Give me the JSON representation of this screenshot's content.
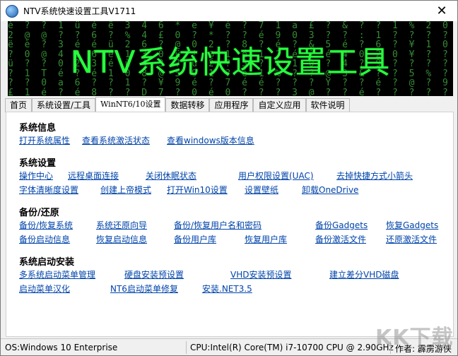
{
  "window": {
    "title": "NTV系统快速设置工具V1711",
    "close_label": "✕"
  },
  "banner": {
    "title": "NTV系统快速设置工具",
    "matrix_rows": [
      "è ? ? 1 ü é ë 3 4 6 * e ¥ é ? 7 1 a £ ? & ? ? 1 % 2 0 ? ? @ 2 ú è ¥ 5 ú",
      "2 @ @ ? ? 6 ? % 4 £ 0 ? * ? ? é 9 0 3 ? ? : 1 ? ? ? ? ë 2 & 4 9 : 2 ? 1",
      "ë è ? 3 é é ü 2 6 ? @ 0 2 ? 8 ? é ? & 5 é ? 6 ? ¥ 1 0 2 8 é 3 @ T a ù",
      "? 0 @ 4 ? 6 é 1 3 0 ü ! @ 1 é 1 ? é ? é 4 0 2 0 ¥ ? ? ? 1 2 4 ? ? ? ? ?",
      "ü ? ? 0 2 3 é ù 4 3 ? ü 2 ? 5 ? è 1 0 ? 4 ? 9 ? ? ? ? 3 ? 6 a 4 ? 9 ?",
      "? 1 T é ? é 1 0 8 @ 5 9 1 ? é 1 % ? ? @ 3 & ? ? 5 % ? ? ? 2 2 ? 3 0 ?",
      "? ? 0 a 6 ? ? 1 ? ¥ 9 é ? 7 é é ? ? ? Y ? ? é ? @ ? 9 2 1 7 ? 8 ? ? ? 9",
      "£ 1 é ? é 8 ? ? D 7 ? 0 é 0 ? ? ? 3 @ ? ? é ? ? ? ? ? ? 4 ? 7 3 ? ? % ?"
    ]
  },
  "tabs": [
    {
      "label": "首页",
      "active": false
    },
    {
      "label": "系统设置/工具",
      "active": false
    },
    {
      "label": "WinNT6/10设置",
      "active": true
    },
    {
      "label": "数据转移",
      "active": false
    },
    {
      "label": "应用程序",
      "active": false
    },
    {
      "label": "自定义应用",
      "active": false
    },
    {
      "label": "软件说明",
      "active": false
    }
  ],
  "sections": {
    "sysinfo": "系统信息",
    "syssettings": "系统设置",
    "backup": "备份/还原",
    "bootinstall": "系统启动安装"
  },
  "links": {
    "open_sys_props": "打开系统属性",
    "view_activation": "查看系统激活状态",
    "view_windows_version": "查看windows版本信息",
    "action_center": "操作中心",
    "remote_desktop": "远程桌面连接",
    "disable_hibernate": "关闭休眠状态",
    "uac_settings": "用户权限设置(UAC)",
    "remove_shortcut_arrow": "去掉快捷方式小箭头",
    "font_clarity": "字体清晰度设置",
    "god_mode": "创建上帝模式",
    "open_win10_settings": "打开Win10设置",
    "set_wallpaper": "设置壁纸",
    "uninstall_onedrive": "卸载OneDrive",
    "backup_restore_system": "备份/恢复系统",
    "system_restore_wizard": "系统还原向导",
    "backup_restore_credentials": "备份/恢复用户名和密码",
    "backup_gadgets": "备份Gadgets",
    "restore_gadgets": "恢复Gadgets",
    "backup_boot_info": "备份启动信息",
    "restore_boot_info": "恢复启动信息",
    "backup_user_store": "备份用户库",
    "restore_user_store": "恢复用户库",
    "backup_activation_files": "备份激活文件",
    "restore_activation_files": "还原激活文件",
    "multi_boot_manager": "多系统启动菜单管理",
    "hdd_install_preset": "硬盘安装预设置",
    "vhd_install_preset": "VHD安装预设置",
    "create_diff_vhd": "建立差分VHD磁盘",
    "boot_menu_chinese": "启动菜单汉化",
    "nt6_boot_repair": "NT6启动菜单修复",
    "install_net35": "安装.NET3.5"
  },
  "status": {
    "os": "OS:Windows 10 Enterprise",
    "cpu": "CPU:Intel(R) Core(TM) i7-10700 CPU @ 2.90GHz",
    "author": "作者: 霹雳游侠"
  },
  "watermark": "KK下载",
  "colors": {
    "link": "#0044aa",
    "banner_text": "#27ff3e",
    "matrix": "#3ea53e",
    "banner_bg": "#000000"
  }
}
